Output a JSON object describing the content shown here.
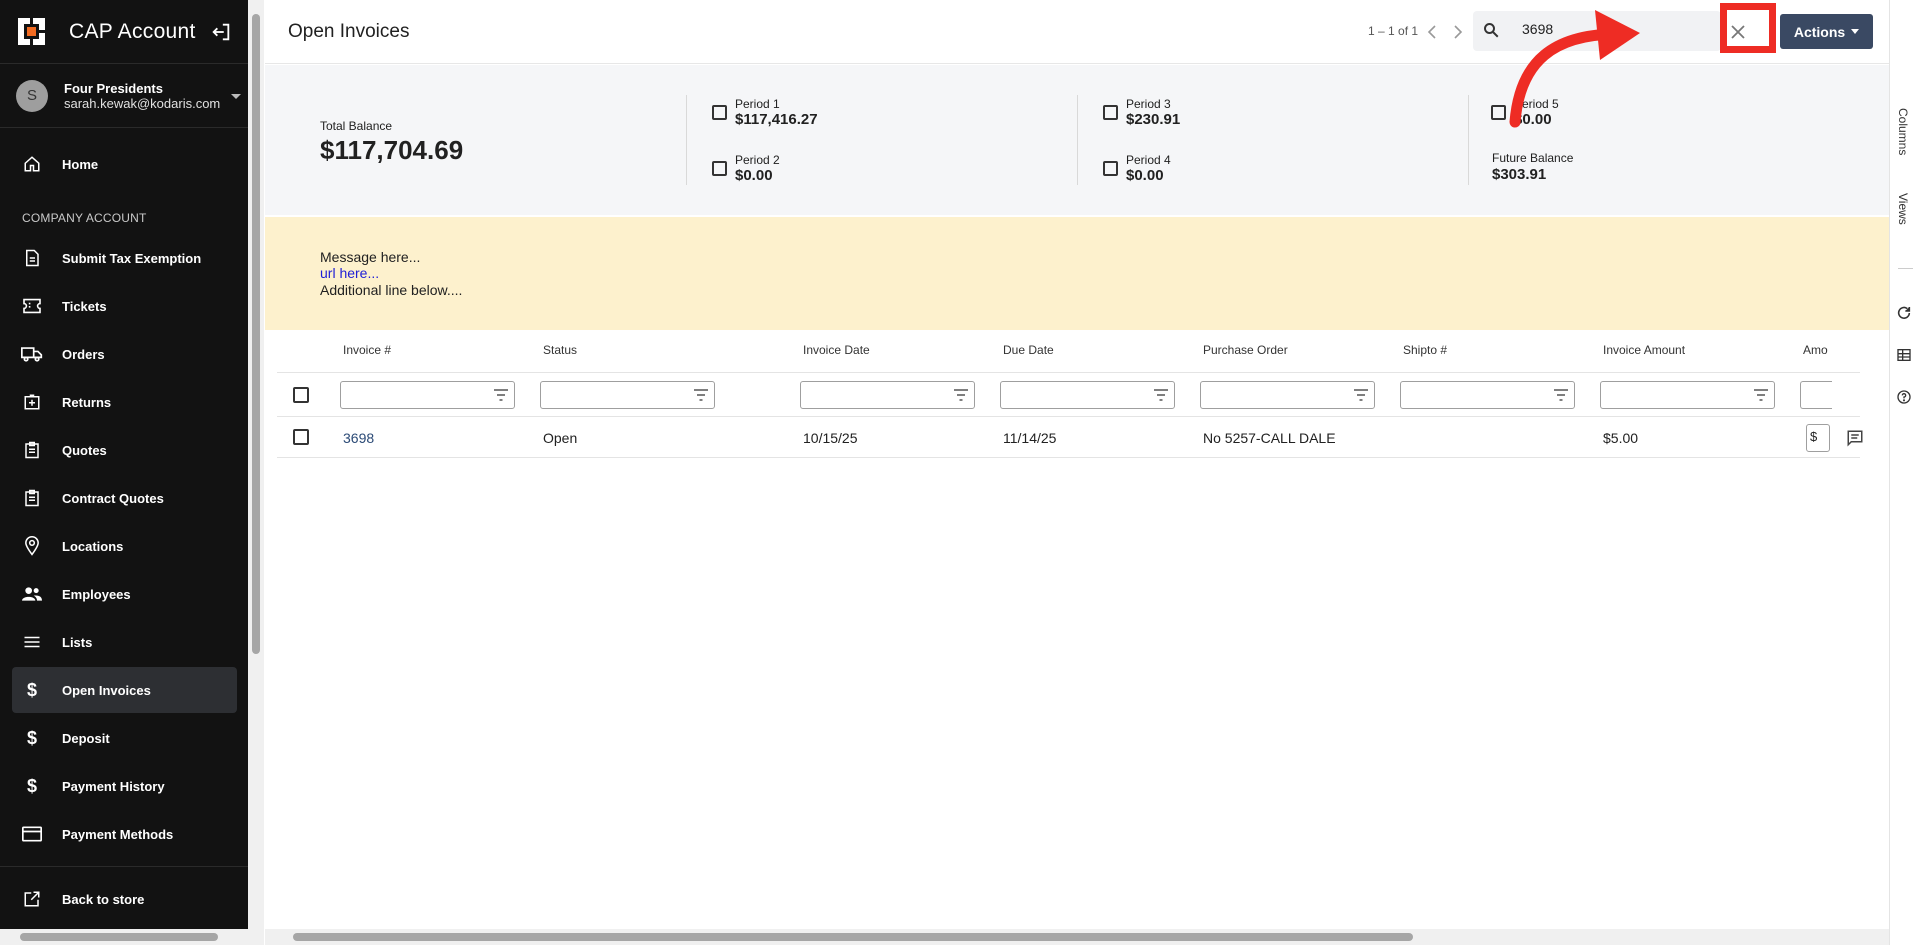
{
  "sidebar": {
    "app_title": "CAP Account",
    "user": {
      "initial": "S",
      "name": "Four Presidents",
      "email": "sarah.kewak@kodaris.com"
    },
    "section_label": "COMPANY ACCOUNT",
    "items": [
      {
        "label": "Home",
        "icon": "home-icon"
      },
      {
        "label": "Submit Tax Exemption",
        "icon": "document-icon"
      },
      {
        "label": "Tickets",
        "icon": "ticket-icon"
      },
      {
        "label": "Orders",
        "icon": "truck-icon"
      },
      {
        "label": "Returns",
        "icon": "return-box-icon"
      },
      {
        "label": "Quotes",
        "icon": "clipboard-icon"
      },
      {
        "label": "Contract Quotes",
        "icon": "clipboard-icon"
      },
      {
        "label": "Locations",
        "icon": "location-pin-icon"
      },
      {
        "label": "Employees",
        "icon": "people-icon"
      },
      {
        "label": "Lists",
        "icon": "list-icon"
      },
      {
        "label": "Open Invoices",
        "icon": "dollar-icon",
        "active": true
      },
      {
        "label": "Deposit",
        "icon": "dollar-icon"
      },
      {
        "label": "Payment History",
        "icon": "dollar-icon"
      },
      {
        "label": "Payment Methods",
        "icon": "credit-card-icon"
      }
    ],
    "back_to_store": "Back to store"
  },
  "header": {
    "title": "Open Invoices",
    "pagination": "1 – 1 of 1",
    "search_value": "3698",
    "actions_label": "Actions"
  },
  "balances": {
    "total_label": "Total Balance",
    "total_value": "$117,704.69",
    "periods": [
      {
        "label": "Period 1",
        "value": "$117,416.27"
      },
      {
        "label": "Period 2",
        "value": "$0.00"
      },
      {
        "label": "Period 3",
        "value": "$230.91"
      },
      {
        "label": "Period 4",
        "value": "$0.00"
      },
      {
        "label": "Period 5",
        "value": "$0.00"
      }
    ],
    "future_label": "Future Balance",
    "future_value": "$303.91"
  },
  "message": {
    "line1": "Message here...",
    "link": "url here...",
    "line3": "Additional line below...."
  },
  "table": {
    "columns": [
      "Invoice #",
      "Status",
      "Invoice Date",
      "Due Date",
      "Purchase Order",
      "Shipto #",
      "Invoice Amount",
      "Amo"
    ],
    "rows": [
      {
        "invoice": "3698",
        "status": "Open",
        "invoice_date": "10/15/25",
        "due_date": "11/14/25",
        "purchase_order": "No 5257-CALL DALE",
        "shipto": "",
        "invoice_amount": "$5.00",
        "amount_prefix": "$"
      }
    ]
  },
  "right_rail": {
    "columns": "Columns",
    "views": "Views"
  },
  "colors": {
    "sidebar_bg": "#121212",
    "accent": "#3a4963",
    "message_bg": "#fdf1cd",
    "annotation": "#ee2c24"
  }
}
